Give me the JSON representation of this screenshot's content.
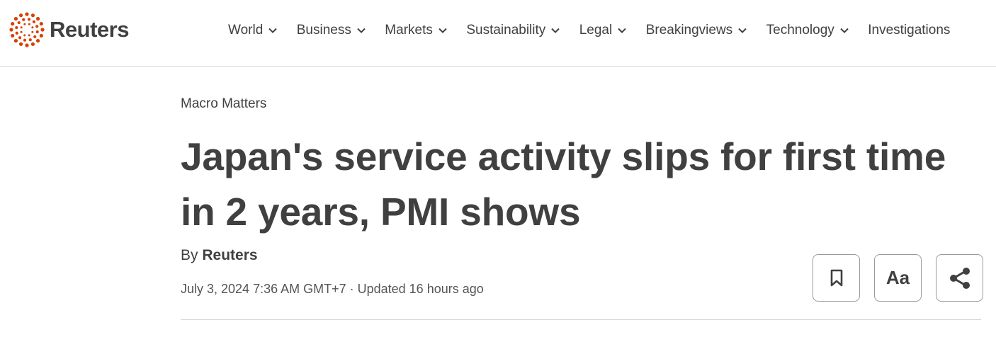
{
  "brand": {
    "name": "Reuters",
    "accent_color": "#d64000"
  },
  "nav": {
    "items": [
      {
        "label": "World"
      },
      {
        "label": "Business"
      },
      {
        "label": "Markets"
      },
      {
        "label": "Sustainability"
      },
      {
        "label": "Legal"
      },
      {
        "label": "Breakingviews"
      },
      {
        "label": "Technology"
      },
      {
        "label": "Investigations"
      }
    ]
  },
  "article": {
    "kicker": "Macro Matters",
    "headline": "Japan's service activity slips for first time in 2 years, PMI shows",
    "byline_prefix": "By",
    "author": "Reuters",
    "dateline": "July 3, 2024 7:36 AM GMT+7 · Updated 16 hours ago"
  },
  "actions": {
    "bookmark_icon": "bookmark-icon",
    "text_size_label": "Aa",
    "share_icon": "share-icon"
  }
}
